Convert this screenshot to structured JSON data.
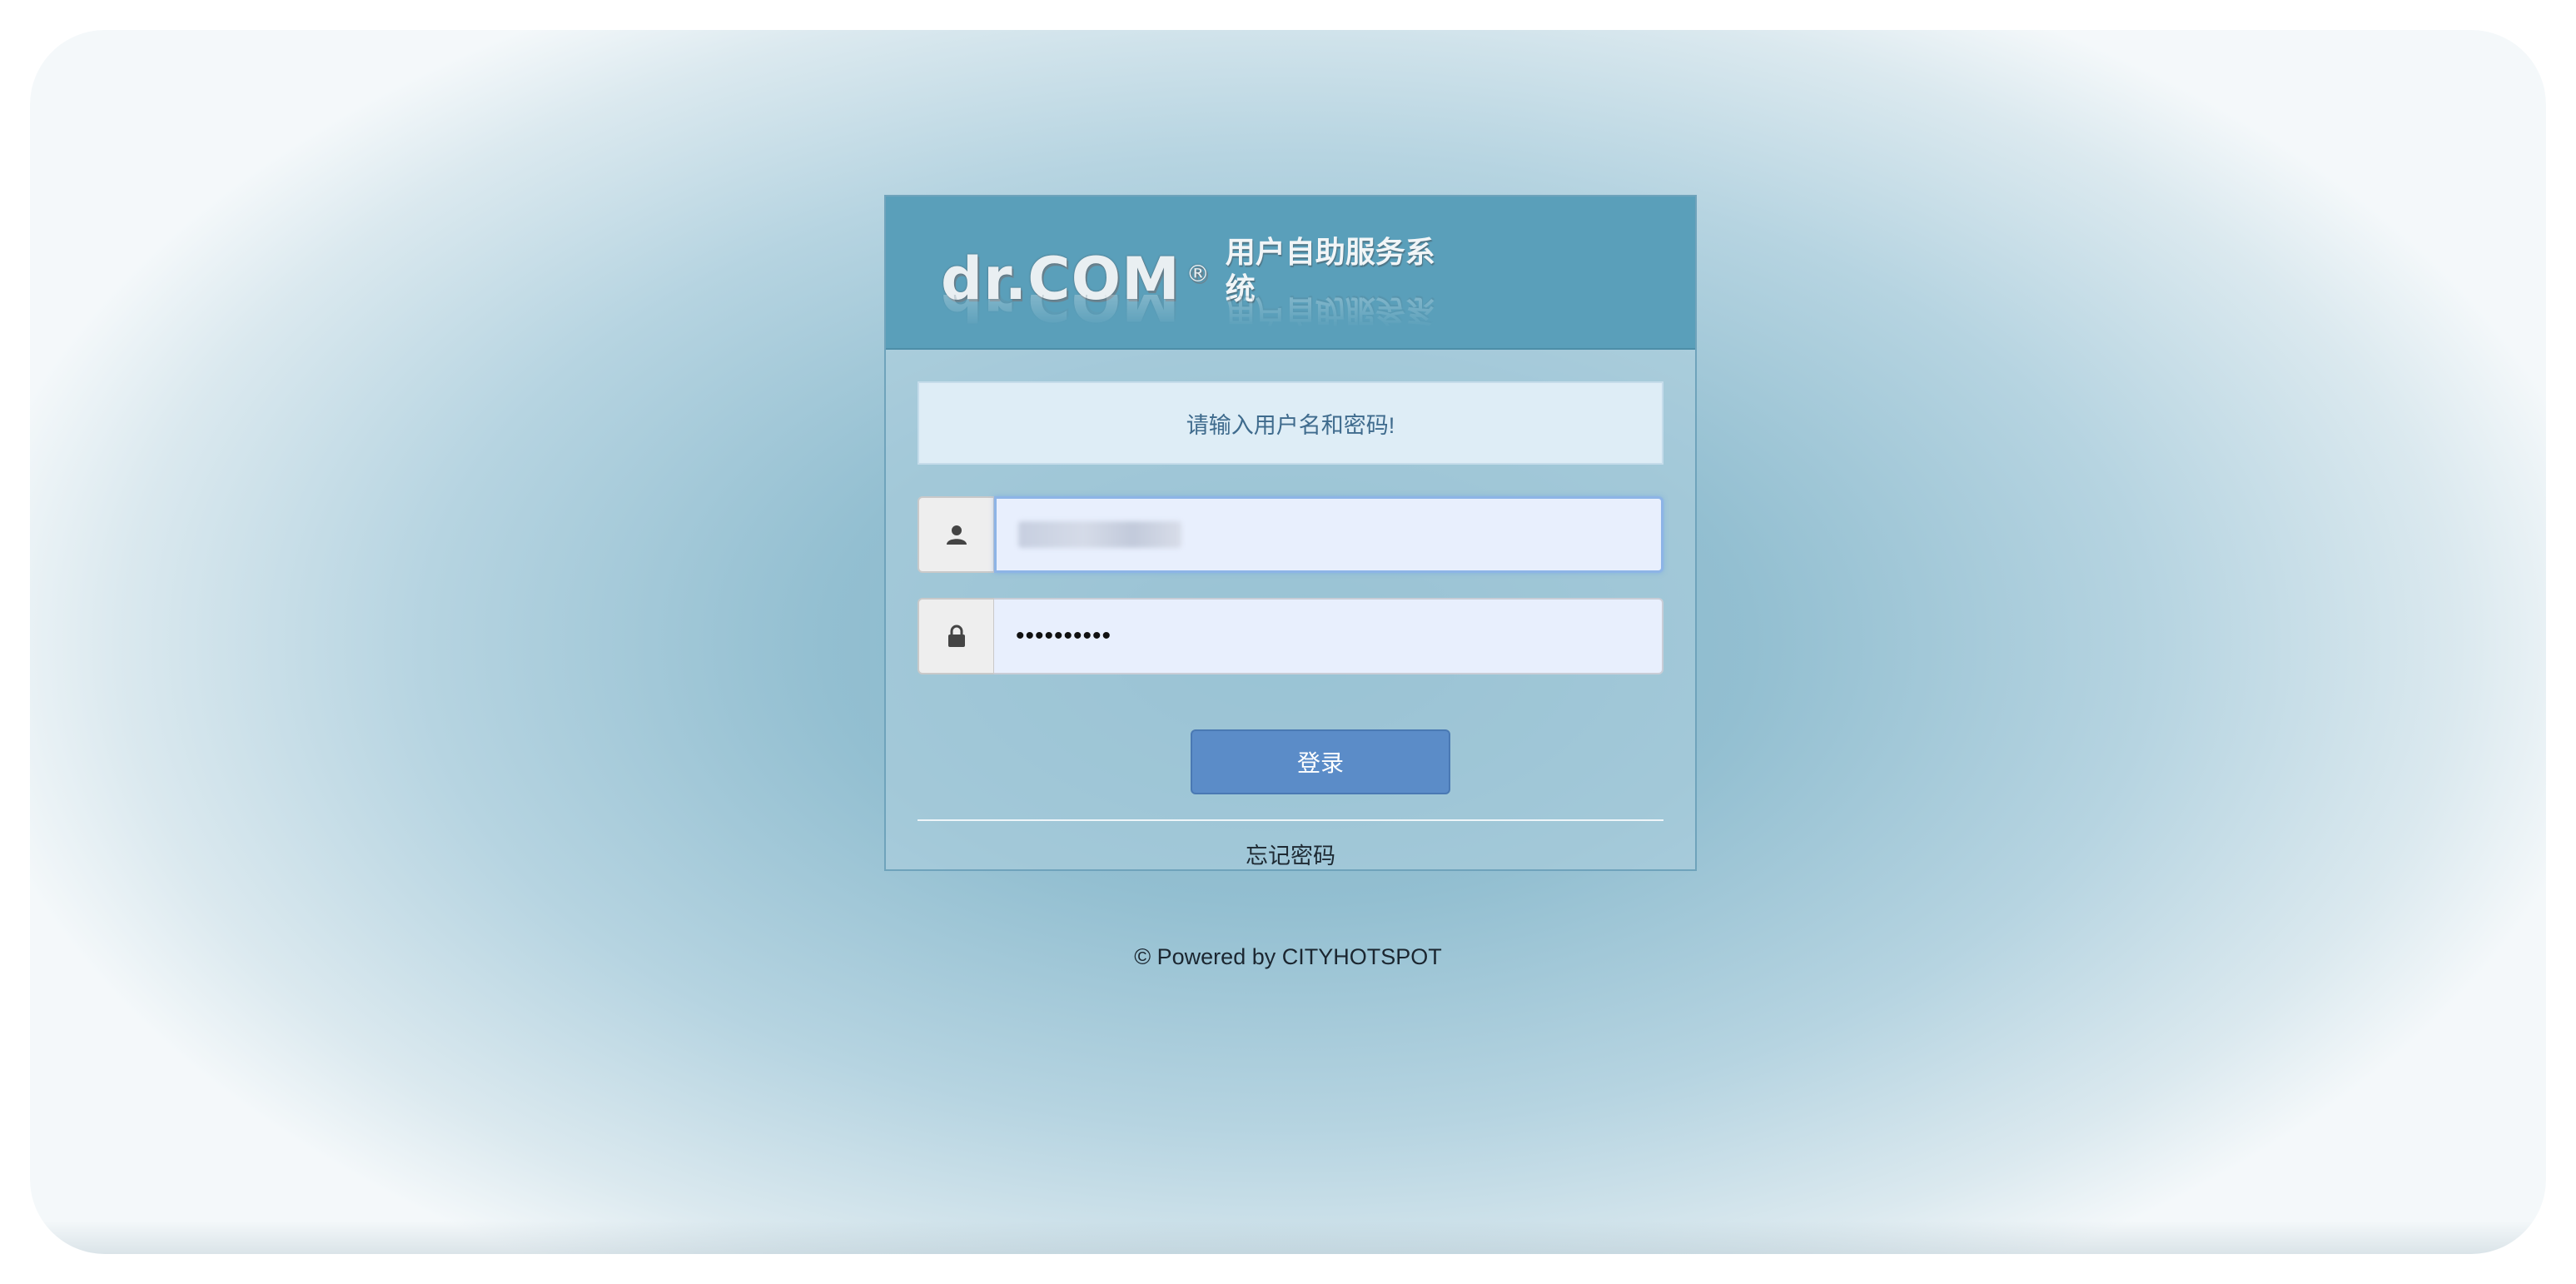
{
  "header": {
    "logo_brand": "dr.COM",
    "logo_reg_mark": "®",
    "logo_subtitle": "用户自助服务系统"
  },
  "notice": {
    "text": "请输入用户名和密码!"
  },
  "form": {
    "username_icon": "user-icon",
    "password_icon": "lock-icon",
    "password_value": "••••••••••",
    "login_label": "登录",
    "forgot_label": "忘记密码"
  },
  "footer": {
    "text": "© Powered by CITYHOTSPOT"
  },
  "colors": {
    "header_bg": "#5a9fba",
    "button_bg": "#5b8cc8",
    "notice_bg": "#deedf6",
    "notice_text": "#3f6b8d"
  }
}
